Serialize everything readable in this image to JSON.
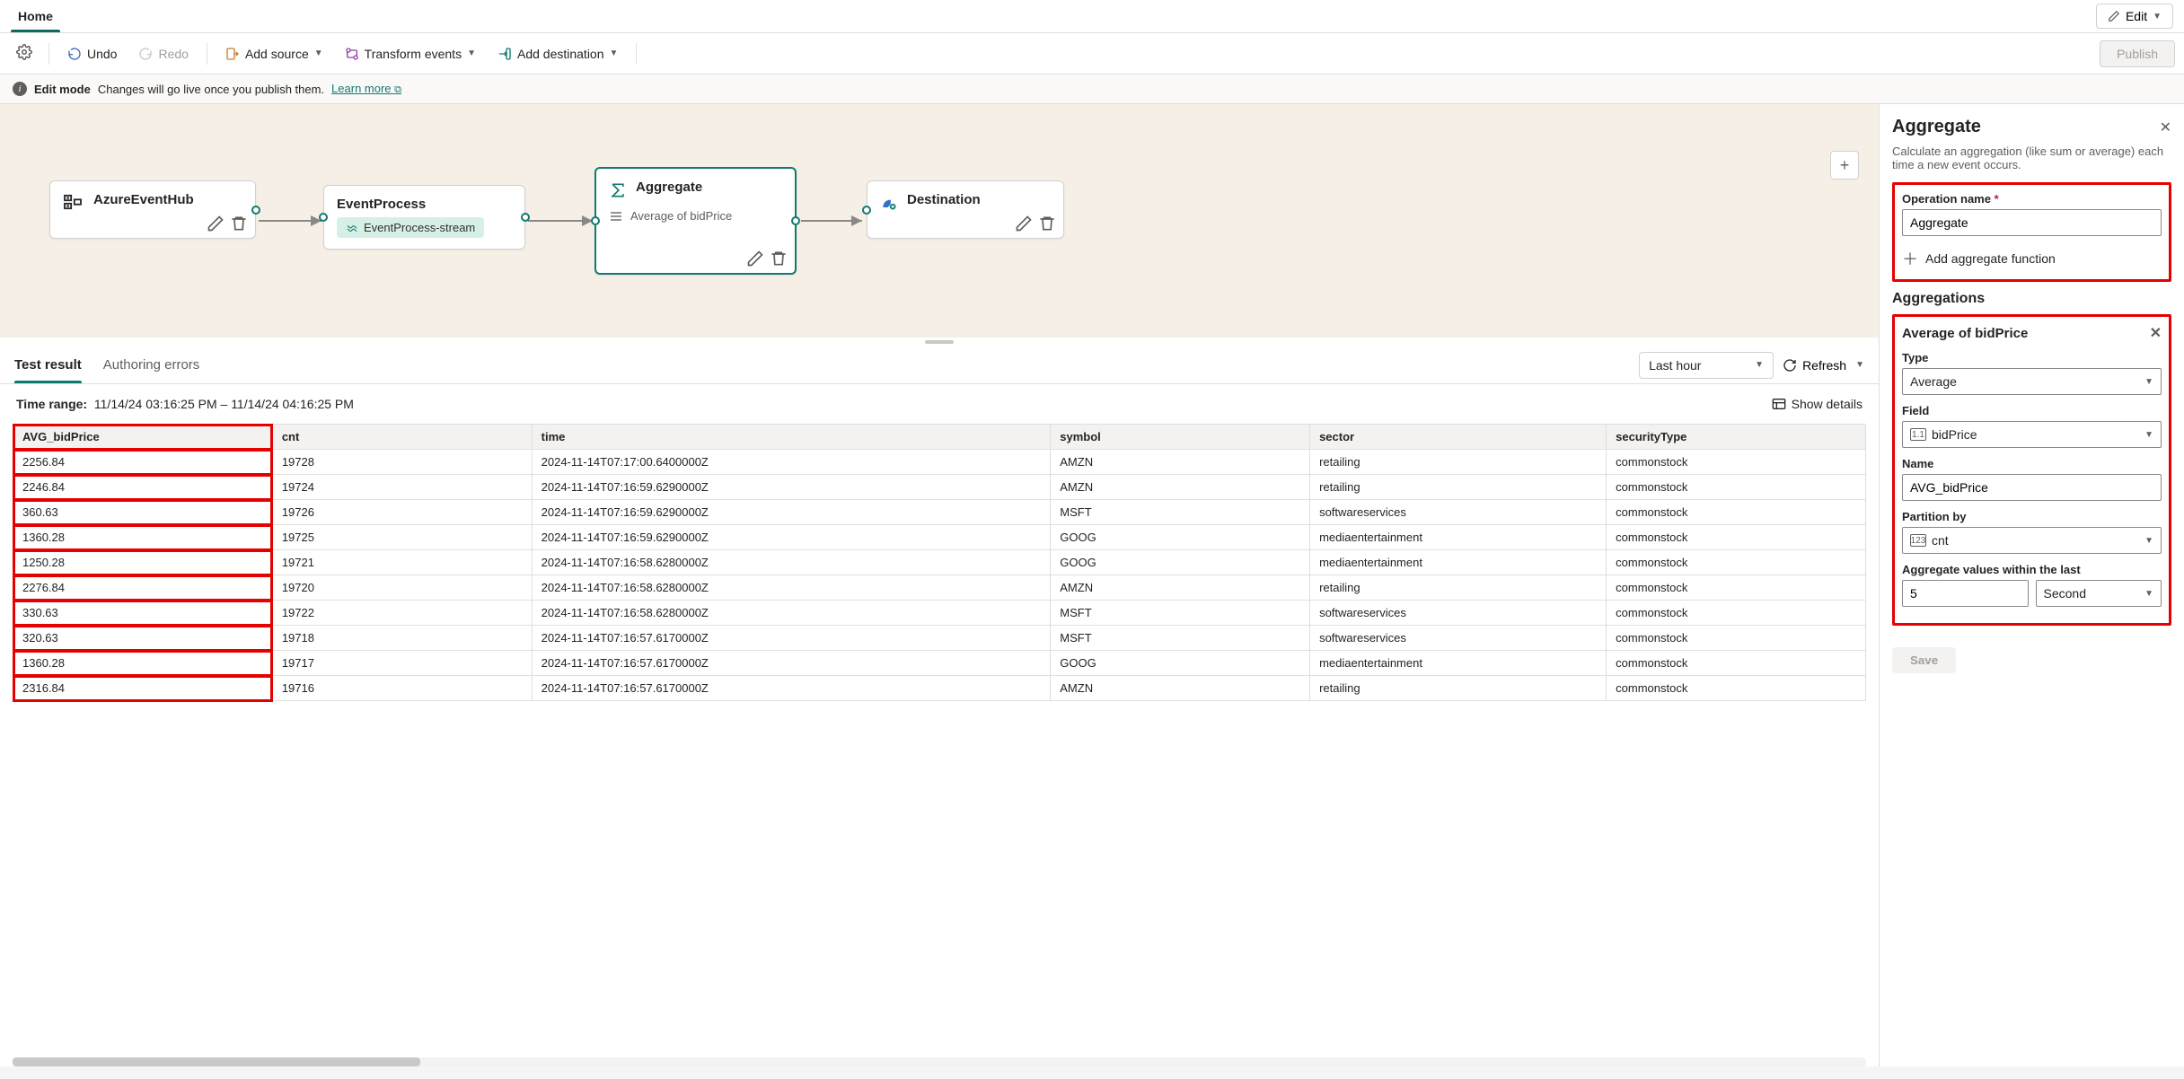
{
  "tabs": {
    "home": "Home"
  },
  "editBtn": "Edit",
  "toolbar": {
    "undo": "Undo",
    "redo": "Redo",
    "addSource": "Add source",
    "transformEvents": "Transform events",
    "addDestination": "Add destination",
    "publish": "Publish"
  },
  "infobar": {
    "title": "Edit mode",
    "msg": "Changes will go live once you publish them.",
    "learn": "Learn more"
  },
  "nodes": {
    "source": {
      "title": "AzureEventHub"
    },
    "process": {
      "title": "EventProcess",
      "stream": "EventProcess-stream"
    },
    "aggregate": {
      "title": "Aggregate",
      "sub": "Average of bidPrice"
    },
    "dest": {
      "title": "Destination"
    }
  },
  "results": {
    "tab1": "Test result",
    "tab2": "Authoring errors",
    "rangeDropdown": "Last hour",
    "refresh": "Refresh",
    "timeRangeLabel": "Time range:",
    "timeRange": "11/14/24 03:16:25 PM – 11/14/24 04:16:25 PM",
    "showDetails": "Show details",
    "columns": [
      "AVG_bidPrice",
      "cnt",
      "time",
      "symbol",
      "sector",
      "securityType"
    ],
    "rows": [
      [
        "2256.84",
        "19728",
        "2024-11-14T07:17:00.6400000Z",
        "AMZN",
        "retailing",
        "commonstock"
      ],
      [
        "2246.84",
        "19724",
        "2024-11-14T07:16:59.6290000Z",
        "AMZN",
        "retailing",
        "commonstock"
      ],
      [
        "360.63",
        "19726",
        "2024-11-14T07:16:59.6290000Z",
        "MSFT",
        "softwareservices",
        "commonstock"
      ],
      [
        "1360.28",
        "19725",
        "2024-11-14T07:16:59.6290000Z",
        "GOOG",
        "mediaentertainment",
        "commonstock"
      ],
      [
        "1250.28",
        "19721",
        "2024-11-14T07:16:58.6280000Z",
        "GOOG",
        "mediaentertainment",
        "commonstock"
      ],
      [
        "2276.84",
        "19720",
        "2024-11-14T07:16:58.6280000Z",
        "AMZN",
        "retailing",
        "commonstock"
      ],
      [
        "330.63",
        "19722",
        "2024-11-14T07:16:58.6280000Z",
        "MSFT",
        "softwareservices",
        "commonstock"
      ],
      [
        "320.63",
        "19718",
        "2024-11-14T07:16:57.6170000Z",
        "MSFT",
        "softwareservices",
        "commonstock"
      ],
      [
        "1360.28",
        "19717",
        "2024-11-14T07:16:57.6170000Z",
        "GOOG",
        "mediaentertainment",
        "commonstock"
      ],
      [
        "2316.84",
        "19716",
        "2024-11-14T07:16:57.6170000Z",
        "AMZN",
        "retailing",
        "commonstock"
      ]
    ]
  },
  "panel": {
    "title": "Aggregate",
    "desc": "Calculate an aggregation (like sum or average) each time a new event occurs.",
    "opNameLabel": "Operation name",
    "opNameValue": "Aggregate",
    "addFn": "Add aggregate function",
    "aggregationsTitle": "Aggregations",
    "itemTitle": "Average of bidPrice",
    "typeLabel": "Type",
    "typeValue": "Average",
    "fieldLabel": "Field",
    "fieldValue": "bidPrice",
    "nameLabel": "Name",
    "nameValue": "AVG_bidPrice",
    "partitionLabel": "Partition by",
    "partitionValue": "cnt",
    "windowLabel": "Aggregate values within the last",
    "windowValue": "5",
    "windowUnit": "Second",
    "save": "Save"
  }
}
